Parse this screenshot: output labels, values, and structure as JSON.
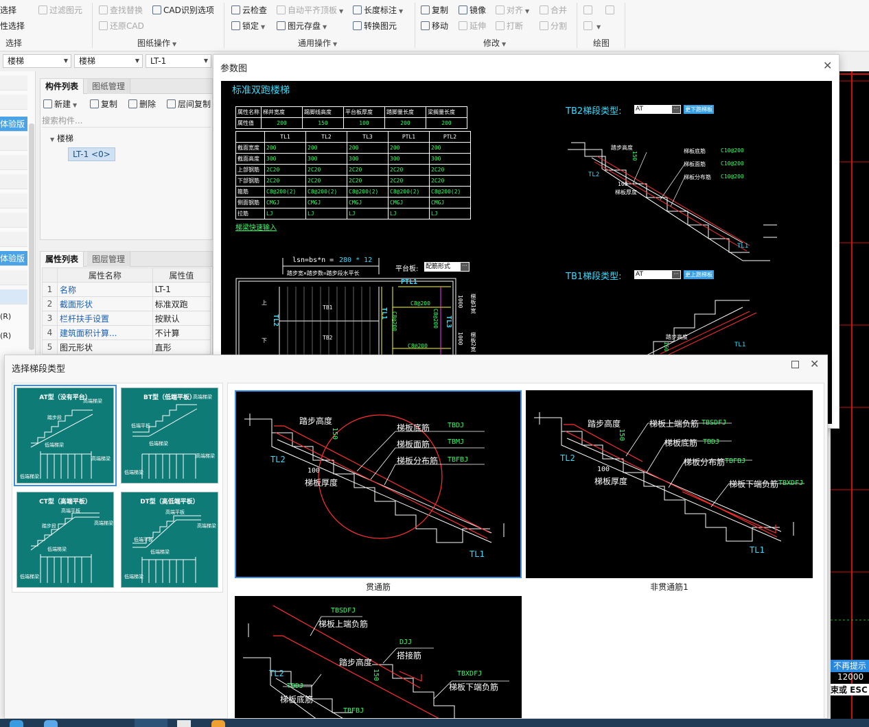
{
  "ribbon": {
    "select_group": {
      "row1": "选择",
      "row2": "性选择",
      "label": "选择",
      "filter": "过滤图元"
    },
    "drawing_ops": {
      "find_replace": "查找替换",
      "restore_cad": "还原CAD",
      "cad_options": "CAD识别选项",
      "label": "图纸操作"
    },
    "general_ops": {
      "cloud_check": "云检查",
      "lock": "锁定",
      "auto_align": "自动平齐顶板",
      "save_elements": "图元存盘",
      "length_dim": "长度标注",
      "convert": "转换图元",
      "label": "通用操作"
    },
    "modify": {
      "copy": "复制",
      "move": "移动",
      "mirror": "镜像",
      "extend": "延伸",
      "align": "对齐",
      "break": "打断",
      "merge": "合并",
      "split": "分割",
      "label": "修改"
    },
    "draw": {
      "label": "绘图"
    }
  },
  "combos": {
    "c1": "楼梯",
    "c2": "楼梯",
    "c3": "LT-1"
  },
  "sidebar": {
    "trial1": "体验版",
    "trial2": "体验版",
    "r1": "(R)",
    "r2": "(R)"
  },
  "component_panel": {
    "tabs": [
      "构件列表",
      "图纸管理"
    ],
    "new": "新建",
    "copy": "复制",
    "delete": "删除",
    "floor_copy": "层间复制",
    "search_placeholder": "搜索构件...",
    "tree_root": "楼梯",
    "tree_item": "LT-1 <0>"
  },
  "property_panel": {
    "tabs": [
      "属性列表",
      "图层管理"
    ],
    "headers": [
      "属性名称",
      "属性值"
    ],
    "rows": [
      {
        "n": "1",
        "name": "名称",
        "value": "LT-1",
        "link": true
      },
      {
        "n": "2",
        "name": "截面形状",
        "value": "标准双跑",
        "link": true
      },
      {
        "n": "3",
        "name": "栏杆扶手设置",
        "value": "按默认",
        "link": true
      },
      {
        "n": "4",
        "name": "建筑面积计算...",
        "value": "不计算",
        "link": true
      },
      {
        "n": "5",
        "name": "图元形状",
        "value": "直形",
        "link": false
      }
    ]
  },
  "param_dialog": {
    "title": "参数图",
    "heading": "标准双跑楼梯",
    "top_table": {
      "headers": [
        "属性名称",
        "梯井宽度",
        "踢脚线高度",
        "平台板厚度",
        "踏脚量长度",
        "梁搁量长度"
      ],
      "row_label": "属性值",
      "values": [
        "200",
        "150",
        "100",
        "200",
        "200"
      ]
    },
    "beam_table": {
      "headers": [
        "TL1",
        "TL2",
        "TL3",
        "PTL1",
        "PTL2"
      ],
      "rows": [
        {
          "label": "截面宽度",
          "values": [
            "200",
            "200",
            "200",
            "200",
            "200"
          ]
        },
        {
          "label": "截面高度",
          "values": [
            "300",
            "300",
            "300",
            "300",
            "300"
          ]
        },
        {
          "label": "上部钢筋",
          "values": [
            "2C20",
            "2C20",
            "2C20",
            "2C20",
            "2C20"
          ]
        },
        {
          "label": "下部钢筋",
          "values": [
            "2C20",
            "2C20",
            "2C20",
            "2C20",
            "2C20"
          ]
        },
        {
          "label": "箍筋",
          "values": [
            "C8@200(2)",
            "C8@200(2)",
            "C8@200(2)",
            "C8@200(2)",
            "C8@200(2)"
          ]
        },
        {
          "label": "侧面钢筋",
          "values": [
            "CMGJ",
            "CMGJ",
            "CMGJ",
            "CMGJ",
            "CMGJ"
          ]
        },
        {
          "label": "拉筋",
          "values": [
            "LJ",
            "LJ",
            "LJ",
            "LJ",
            "LJ"
          ]
        }
      ]
    },
    "quick_input": "梯梁快速输入",
    "formula_l": "lsn=bs*n =",
    "formula_v": "280 * 12",
    "formula_note": "踏步宽×踏步数=踏步段水平长",
    "platform_label": "平台板:",
    "platform_value": "配筋形式",
    "tb2_label": "TB2梯段类型:",
    "tb2_value": "AT",
    "tb2_btn": "更下跑梯板",
    "tb1_label": "TB1梯段类型:",
    "tb1_value": "AT",
    "tb1_btn": "更上跑梯板",
    "tb2_annot": {
      "step_h": "踏步高度",
      "v150": "150",
      "bottom": "梯板底筋",
      "bottom_v": "C10@200",
      "face": "梯板面筋",
      "face_v": "C10@200",
      "dist": "梯板分布筋",
      "dist_v": "C10@200",
      "v100": "100",
      "thick": "梯板厚度",
      "tl2": "TL2",
      "tl1": "TL1"
    },
    "plan": {
      "ptl1": "PTL1",
      "c8a": "C8@200",
      "c8b": "C8@200",
      "c8c": "C8@200",
      "c8d": "C8@200",
      "tb1": "TB1",
      "tb2": "TB2",
      "up": "上",
      "down": "下",
      "tl2": "TL2",
      "tl1": "TL1",
      "tl3": "TL3",
      "d1000a": "1000",
      "d1000b": "1000",
      "w1": "梯板1宽",
      "w2": "梯板2宽"
    },
    "tb1_annot": {
      "step_h": "踏步高度",
      "v150": "150",
      "tl1": "TL1"
    }
  },
  "select_dialog": {
    "title": "选择梯段类型",
    "types": [
      {
        "name": "AT型（没有平台）",
        "a": "高端梯梁",
        "b": "踏步段",
        "c": "低端梯梁",
        "d": "高端梯梁",
        "e": "低端梯梁"
      },
      {
        "name": "BT型（低端平板）",
        "a": "高端梯梁",
        "b": "低端平板",
        "c": "低端梯梁",
        "d": "高端梯梁",
        "e": "低端梯梁"
      },
      {
        "name": "CT型（高端平板）",
        "a": "高端平板",
        "b": "踏步段",
        "c": "高端梯梁",
        "d": "低端梯梁",
        "e": "低端梯梁"
      },
      {
        "name": "DT型（高低端平板）",
        "a": "高端平板",
        "b": "低端平板",
        "c": "高端梯梁",
        "d": "低端梯梁",
        "e": "低端梯梁"
      }
    ],
    "options": [
      {
        "caption": "贯通筋",
        "step_h": "踏步高度",
        "v150": "150",
        "bottom": "梯板底筋",
        "bottom_c": "TBDJ",
        "face": "梯板面筋",
        "face_c": "TBMJ",
        "dist": "梯板分布筋",
        "dist_c": "TBFBJ",
        "v100": "100",
        "thick": "梯板厚度",
        "tl2": "TL2",
        "tl1": "TL1"
      },
      {
        "caption": "非贯通筋1",
        "step_h": "踏步高度",
        "v150": "150",
        "upper": "梯板上端负筋",
        "upper_c": "TBSDFJ",
        "bottom": "梯板底筋",
        "bottom_c": "TBDJ",
        "dist": "梯板分布筋",
        "dist_c": "TBFBJ",
        "lower": "梯板下端负筋",
        "lower_c": "TBXDFJ",
        "v100": "100",
        "thick": "梯板厚度",
        "tl2": "TL2",
        "tl1": "TL1"
      },
      {
        "caption": "",
        "upper_c": "TBSDFJ",
        "upper": "梯板上端负筋",
        "djj_c": "DJJ",
        "djj": "搭接筋",
        "step_h": "踏步高度",
        "v150": "150",
        "lower_c": "TBXDFJ",
        "lower": "梯板下端负筋",
        "tl2": "TL2",
        "bottom_c": "TBDJ",
        "bottom": "梯板底筋",
        "dist_c": "TBFBJ"
      }
    ]
  },
  "right_edge": {
    "tip": "不再提示",
    "num": "12000",
    "esc": "束或 ESC 即"
  }
}
